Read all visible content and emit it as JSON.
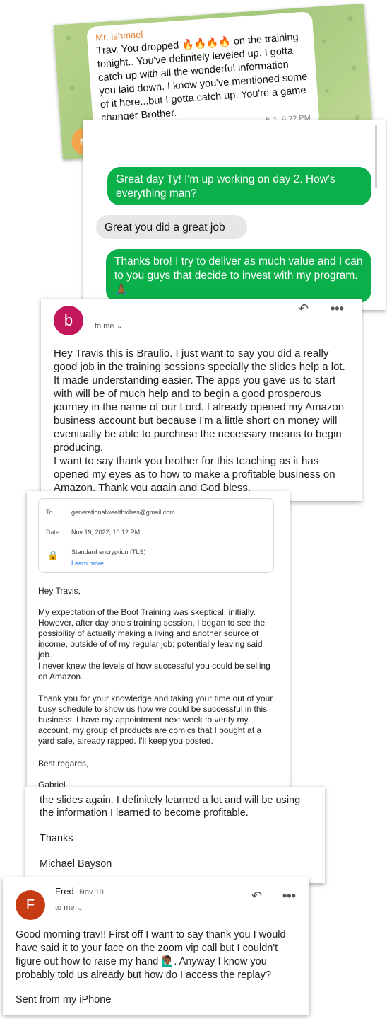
{
  "telegram": {
    "sender": "Mr. Ishmael",
    "message_prefix": "Trav. You dropped",
    "message_rest": "on the training tonight.. You've definitely leveled up. I gotta catch up with all the wonderful information you laid down. I know you've mentioned some of it here...but I gotta catch up. You're a game changer Brother.",
    "time": "9:22 PM",
    "view_count": "1",
    "avatar_initials": "MI"
  },
  "imessage": {
    "bubbles": [
      {
        "type": "sent",
        "text": "Great day Ty! I'm up working on day 2. How's everything man?"
      },
      {
        "type": "received",
        "text": "Great you did a great job"
      },
      {
        "type": "sent",
        "text": "Thanks bro! I try to deliver as much value and I can to you guys that decide to invest with my program.🙏🏾"
      }
    ]
  },
  "email_braulio": {
    "avatar_letter": "b",
    "to_me": "to me",
    "body_para1": "Hey Travis this is Braulio. I just want to say you did a really good job in the training sessions specially the slides help a lot. It made understanding easier. The apps you gave us to start with will be of much help and to begin a good prosperous journey in the name of our Lord. I already opened my Amazon business account but because I'm a little short on money will eventually be able to purchase the necessary means to begin producing.",
    "body_para2": "I want to say thank you brother for this teaching as it has opened my eyes as to how to make a profitable business on Amazon. Thank you again and God bless."
  },
  "email_gabriel": {
    "meta": {
      "to_label": "To",
      "to_value": "generationalwealthvibes@gmail.com",
      "date_label": "Date",
      "date_value": "Nov 19, 2022, 10:12 PM",
      "encryption": "Standard encryption (TLS)",
      "learn_more": "Learn more"
    },
    "greeting": "Hey Travis,",
    "para1": "My expectation of the Boot Training was skeptical, initially. However, after day one's training session, I began to see the possibility of actually making a living and another source of income, outside of of my regular job; potentially leaving said job.",
    "para1b": "I never knew the levels of how successful you could be selling on Amazon.",
    "para2": "Thank you for your knowledge and taking your time out of your busy schedule to show us how we could be successful in this business. I have my appointment next week to verify my account, my group of products are comics that I bought at a yard sale, already rapped. I'll keep you posted.",
    "closing": "Best regards,",
    "signature": "Gabriel"
  },
  "email_michael": {
    "body": "the slides again.  I definitely learned a lot and will be using the information I learned to become profitable.",
    "thanks": "Thanks",
    "signature": "Michael Bayson"
  },
  "email_fred": {
    "avatar_letter": "F",
    "sender": "Fred",
    "date": "Nov 19",
    "to_me": "to me",
    "body_part1": "Good morning trav!! First off I want to say thank you I would have said it to your face on the zoom vip call but I couldn't figure out how to raise my hand",
    "body_part2": ". Anyway I know you probably told us already but  how do I access the replay?",
    "footer": "Sent from my iPhone"
  }
}
